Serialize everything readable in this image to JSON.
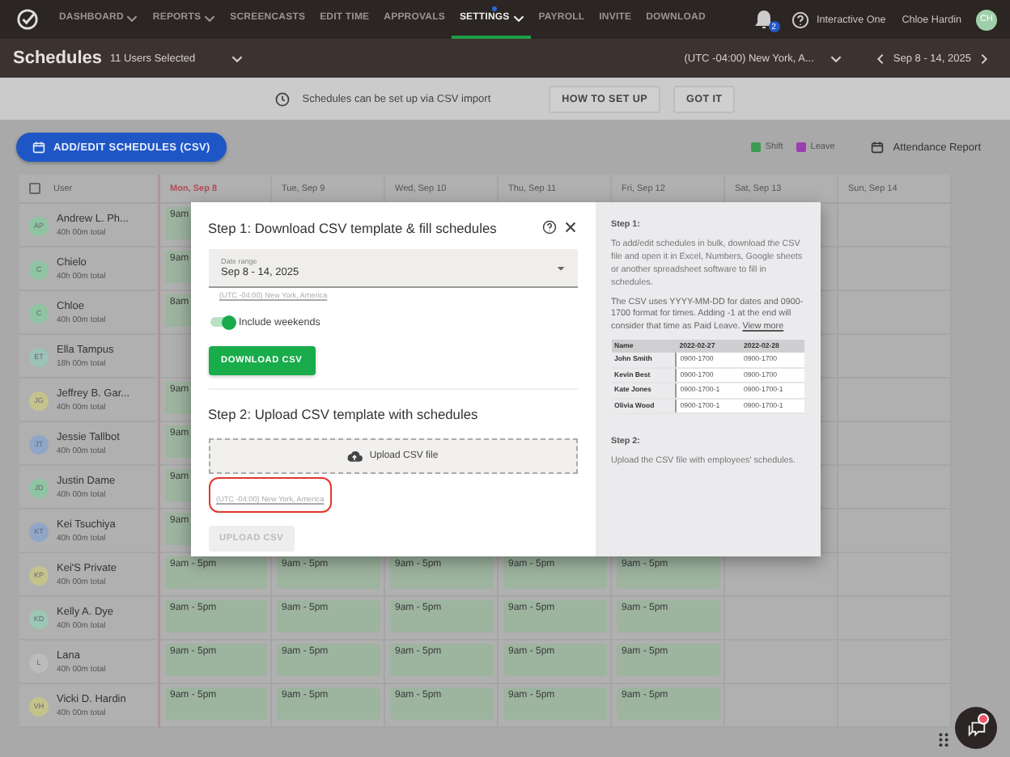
{
  "nav": {
    "items": [
      {
        "label": "DASHBOARD",
        "dropdown": true,
        "selected": false
      },
      {
        "label": "REPORTS",
        "dropdown": true,
        "selected": false
      },
      {
        "label": "SCREENCASTS",
        "dropdown": false,
        "selected": false
      },
      {
        "label": "EDIT TIME",
        "dropdown": false,
        "selected": false
      },
      {
        "label": "APPROVALS",
        "dropdown": false,
        "selected": false
      },
      {
        "label": "SETTINGS",
        "dropdown": true,
        "selected": true
      },
      {
        "label": "PAYROLL",
        "dropdown": false,
        "selected": false
      },
      {
        "label": "INVITE",
        "dropdown": false,
        "selected": false
      },
      {
        "label": "DOWNLOAD",
        "dropdown": false,
        "selected": false
      }
    ],
    "notifications": "2",
    "account": "Interactive One",
    "user": "Chloe Hardin",
    "avatar": "CH"
  },
  "toolbar": {
    "title": "Schedules",
    "users": "11 Users Selected",
    "timezone": "(UTC -04:00) New York, A...",
    "range": "Sep 8 - 14, 2025"
  },
  "banner": {
    "text": "Schedules can be set up via CSV import",
    "buttons": [
      "HOW TO SET UP",
      "GOT IT"
    ]
  },
  "actions": {
    "add_button": "ADD/EDIT SCHEDULES (CSV)",
    "legend": [
      {
        "label": "Shift",
        "color": "#3d9b4f"
      },
      {
        "label": "Leave",
        "color": "#9c3fb0"
      }
    ],
    "report": "Attendance Report"
  },
  "table": {
    "user_header": "User",
    "select_all_checked": false,
    "days": [
      {
        "label": "Mon, Sep 8",
        "today": true
      },
      {
        "label": "Tue, Sep 9",
        "today": false
      },
      {
        "label": "Wed, Sep 10",
        "today": false
      },
      {
        "label": "Thu, Sep 11",
        "today": false
      },
      {
        "label": "Fri, Sep 12",
        "today": false
      },
      {
        "label": "Sat, Sep 13",
        "today": false
      },
      {
        "label": "Sun, Sep 14",
        "today": false
      }
    ],
    "rows": [
      {
        "initials": "AP",
        "color": "#8fc4a2",
        "name": "Andrew L. Ph...",
        "total": "40h 00m total",
        "shifts": [
          "9am"
        ]
      },
      {
        "initials": "C",
        "color": "#8fc4a2",
        "name": "Chielo",
        "total": "40h 00m total",
        "shifts": [
          "9am"
        ]
      },
      {
        "initials": "C",
        "color": "#8fc4a2",
        "name": "Chloe",
        "total": "40h 00m total",
        "shifts": [
          "8am"
        ]
      },
      {
        "initials": "ET",
        "color": "#9cc2b6",
        "name": "Ella Tampus",
        "total": "18h 00m total"
      },
      {
        "initials": "JG",
        "color": "#c6c28c",
        "name": "Jeffrey B. Gar...",
        "total": "40h 00m total",
        "shifts": [
          "9am"
        ]
      },
      {
        "initials": "JT",
        "color": "#8fa6c6",
        "name": "Jessie Tallbot",
        "total": "40h 00m total",
        "shifts": [
          "9am"
        ]
      },
      {
        "initials": "JD",
        "color": "#8fc4a2",
        "name": "Justin Dame",
        "total": "40h 00m total",
        "shifts": [
          "9am"
        ]
      },
      {
        "initials": "KT",
        "color": "#8fa6c6",
        "name": "Kei Tsuchiya",
        "total": "40h 00m total",
        "shifts": [
          "9am"
        ]
      },
      {
        "initials": "KP",
        "color": "#c6c28c",
        "name": "Kei'S Private",
        "total": "40h 00m total",
        "shifts": [
          "9am - 5pm",
          "9am - 5pm",
          "9am - 5pm",
          "9am - 5pm",
          "9am - 5pm"
        ]
      },
      {
        "initials": "KD",
        "color": "#9cc7b4",
        "name": "Kelly A. Dye",
        "total": "40h 00m total",
        "shifts": [
          "9am - 5pm",
          "9am - 5pm",
          "9am - 5pm",
          "9am - 5pm",
          "9am - 5pm"
        ]
      },
      {
        "initials": "L",
        "color": "#bcbcbc",
        "name": "Lana",
        "total": "40h 00m total",
        "shifts": [
          "9am - 5pm",
          "9am - 5pm",
          "9am - 5pm",
          "9am - 5pm",
          "9am - 5pm"
        ]
      },
      {
        "initials": "VH",
        "color": "#c6c28c",
        "name": "Vicki D. Hardin",
        "total": "40h 00m total",
        "shifts": [
          "9am - 5pm",
          "9am - 5pm",
          "9am - 5pm",
          "9am - 5pm",
          "9am - 5pm"
        ]
      }
    ]
  },
  "modal": {
    "step1_title": "Step 1: Download CSV template & fill schedules",
    "date_field": {
      "label": "Date range",
      "value": "Sep 8 - 14, 2025"
    },
    "timezone_link": "(UTC -04:00) New York, America",
    "weekends": {
      "label": "Include weekends",
      "on": true
    },
    "download_button": "DOWNLOAD CSV",
    "step2_title": "Step 2: Upload CSV template with schedules",
    "upload": "Upload CSV file",
    "upload_timezone": {
      "text": "(UTC -04:00) New York, America",
      "highlighted": true
    },
    "upload_button": {
      "label": "UPLOAD CSV",
      "disabled": true
    },
    "help": {
      "step1_heading": "Step 1:",
      "step1_text": "To add/edit schedules in bulk, download the CSV file and open it in Excel, Numbers, Google sheets or another spreadsheet software to fill in schedules.",
      "format_text": "The CSV uses YYYY-MM-DD for dates and 0900-1700 format for times. Adding -1 at the end will consider that time as Paid Leave.",
      "view_more": "View more",
      "sample": {
        "columns": [
          "Name",
          "2022-02-27",
          "2022-02-28"
        ],
        "rows": [
          [
            "John Smith",
            "0900-1700",
            "0900-1700"
          ],
          [
            "Kevin Best",
            "0900-1700",
            "0900-1700"
          ],
          [
            "Kate Jones",
            "0900-1700-1",
            "0900-1700-1"
          ],
          [
            "Olivia Wood",
            "0900-1700-1",
            "0900-1700-1"
          ]
        ]
      },
      "step2_heading": "Step 2:",
      "step2_text": "Upload the CSV file with employees' schedules."
    }
  },
  "chat": {
    "unread": true
  }
}
